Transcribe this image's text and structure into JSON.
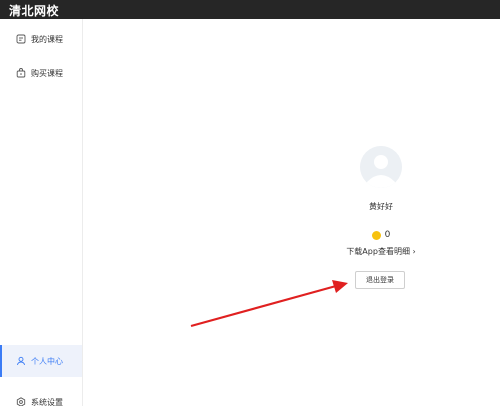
{
  "app": {
    "title": "清北网校"
  },
  "sidebar": {
    "items": [
      {
        "label": "我的课程",
        "icon": "course-icon",
        "active": false
      },
      {
        "label": "购买课程",
        "icon": "shopping-bag-icon",
        "active": false
      },
      {
        "label": "个人中心",
        "icon": "user-icon",
        "active": true
      },
      {
        "label": "系统设置",
        "icon": "gear-icon",
        "active": false
      }
    ]
  },
  "profile": {
    "username": "黄好好",
    "coins": "0",
    "download_link": "下载App查看明细 ›",
    "logout_label": "退出登录",
    "avatar_icon": "default-avatar-icon"
  },
  "colors": {
    "titlebar_bg": "#262626",
    "active_accent": "#3b7cf5",
    "active_bg": "#eef2fb",
    "coin": "#f7c20f",
    "annotation_arrow": "#e02020"
  },
  "annotation": {
    "icon": "red-arrow-annotation-icon",
    "points_to": "logout-button"
  }
}
